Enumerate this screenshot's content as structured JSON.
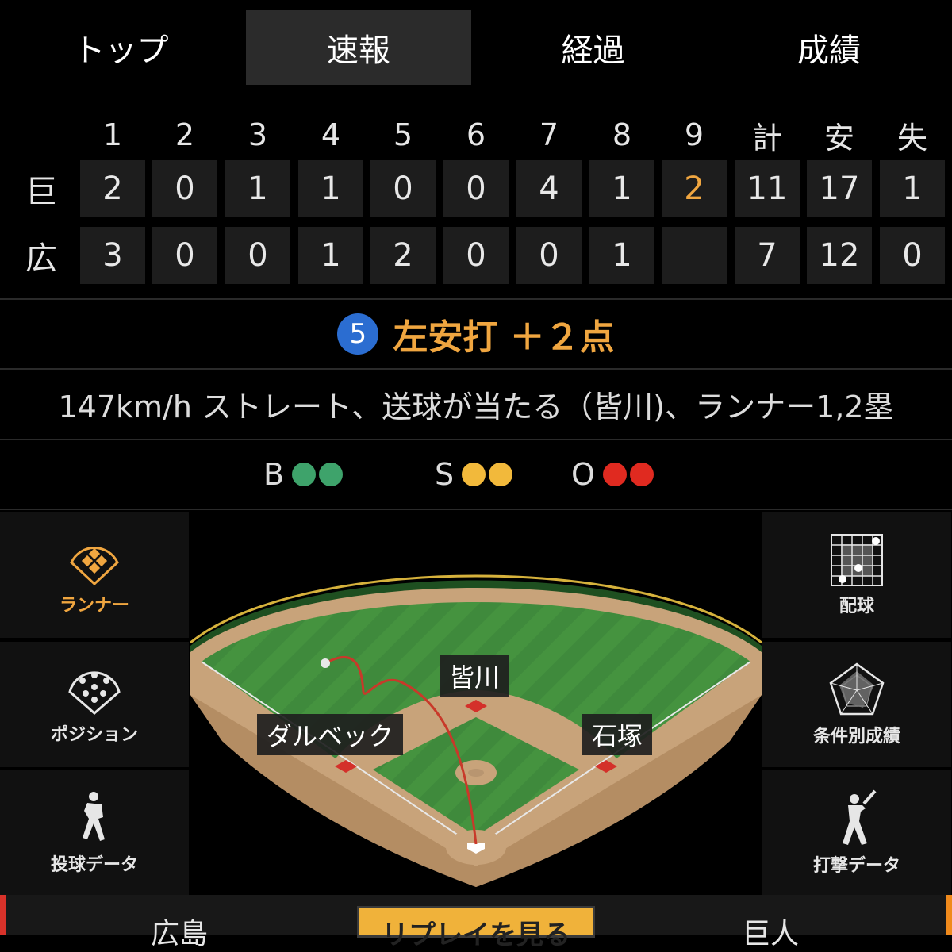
{
  "tabs": [
    {
      "label": "トップ",
      "active": false
    },
    {
      "label": "速報",
      "active": true
    },
    {
      "label": "経過",
      "active": false
    },
    {
      "label": "成績",
      "active": false
    }
  ],
  "scoreboard": {
    "headers": [
      "1",
      "2",
      "3",
      "4",
      "5",
      "6",
      "7",
      "8",
      "9",
      "計",
      "安",
      "失"
    ],
    "rows": [
      {
        "team": "巨",
        "cells": [
          "2",
          "0",
          "1",
          "1",
          "0",
          "0",
          "4",
          "1",
          "2",
          "11",
          "17",
          "1"
        ]
      },
      {
        "team": "広",
        "cells": [
          "3",
          "0",
          "0",
          "1",
          "2",
          "0",
          "0",
          "1",
          "",
          "7",
          "12",
          "0"
        ]
      }
    ],
    "highlight_color": "#f0a640"
  },
  "play": {
    "batter_number": "5",
    "result": "左安打 ＋２点",
    "description": "147km/h ストレート、送球が当たる（皆川)、ランナー1,2塁"
  },
  "count": {
    "balls_label": "B",
    "balls": 2,
    "balls_color": "#3ea36b",
    "strikes_label": "S",
    "strikes": 2,
    "strikes_color": "#f2b93b",
    "outs_label": "O",
    "outs": 2,
    "outs_color": "#e02a20"
  },
  "left_menu": [
    {
      "label": "ランナー",
      "icon": "runner-diamond-icon",
      "active": true
    },
    {
      "label": "ポジション",
      "icon": "position-icon",
      "active": false
    },
    {
      "label": "投球データ",
      "icon": "pitcher-icon",
      "active": false
    }
  ],
  "right_menu": [
    {
      "label": "配球",
      "icon": "pitch-grid-icon"
    },
    {
      "label": "条件別成績",
      "icon": "radar-icon"
    },
    {
      "label": "打撃データ",
      "icon": "batter-icon"
    }
  ],
  "field": {
    "players": [
      {
        "name": "皆川",
        "base": "second"
      },
      {
        "name": "ダルベック",
        "base": "third"
      },
      {
        "name": "石塚",
        "base": "first"
      }
    ]
  },
  "bottom": {
    "left_team": "広島",
    "replay_label": "リプレイを見る",
    "right_team": "巨人",
    "left_color": "#d8322a",
    "right_color": "#f08a1c"
  }
}
